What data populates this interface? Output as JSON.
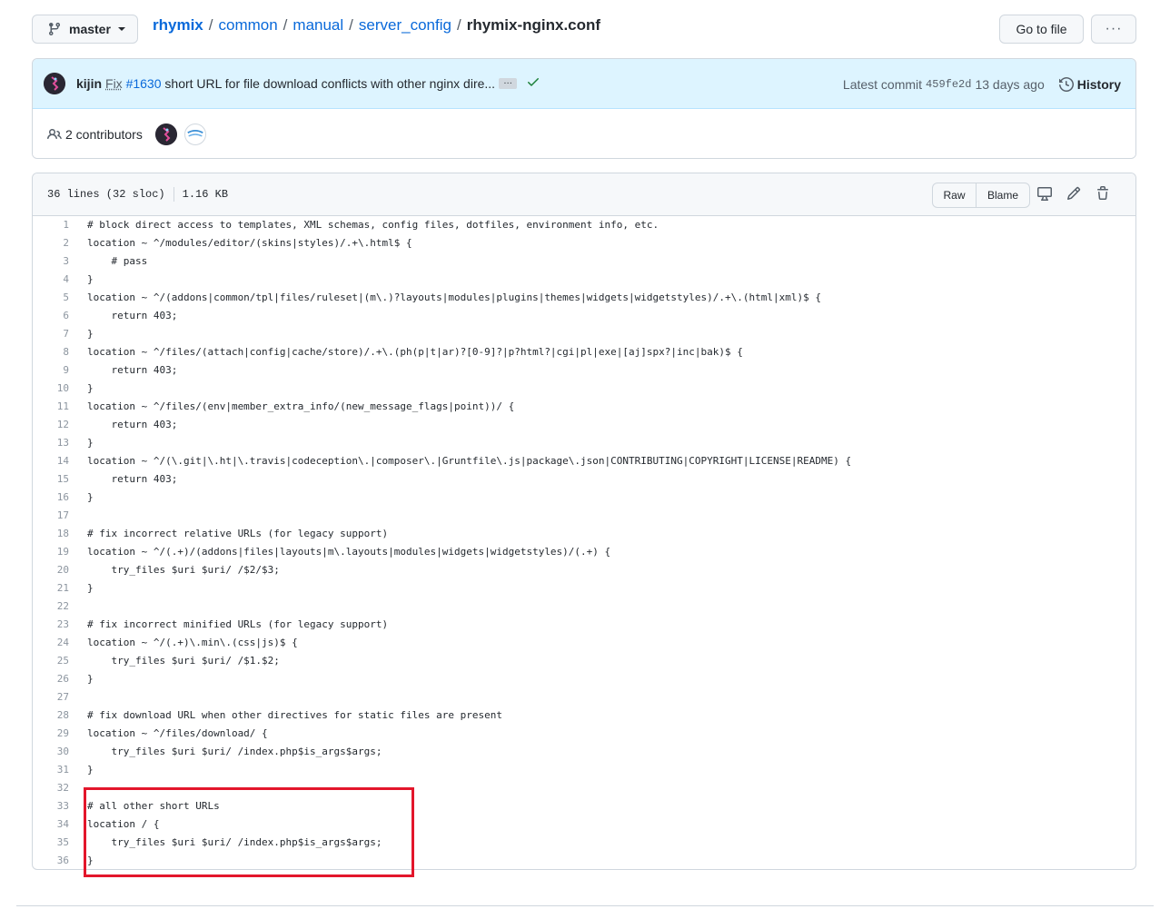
{
  "branch": {
    "label": "master"
  },
  "breadcrumb": {
    "repo": "rhymix",
    "parts": [
      "common",
      "manual",
      "server_config"
    ],
    "file": "rhymix-nginx.conf"
  },
  "top_actions": {
    "go_to_file": "Go to file",
    "more": "···"
  },
  "commit": {
    "author": "kijin",
    "fix_word": "Fix",
    "issue": "#1630",
    "message_rest": "short URL for file download conflicts with other nginx dire...",
    "ellipsis": "…",
    "latest_label": "Latest commit",
    "sha": "459fe2d",
    "time_ago": "13 days ago",
    "history_label": "History",
    "status_color": "#1a7f37"
  },
  "contributors": {
    "label": "2 contributors"
  },
  "file": {
    "lines_info": "36 lines (32 sloc)",
    "size": "1.16 KB",
    "raw_label": "Raw",
    "blame_label": "Blame"
  },
  "code_lines": [
    "# block direct access to templates, XML schemas, config files, dotfiles, environment info, etc.",
    "location ~ ^/modules/editor/(skins|styles)/.+\\.html$ {",
    "    # pass",
    "}",
    "location ~ ^/(addons|common/tpl|files/ruleset|(m\\.)?layouts|modules|plugins|themes|widgets|widgetstyles)/.+\\.(html|xml)$ {",
    "    return 403;",
    "}",
    "location ~ ^/files/(attach|config|cache/store)/.+\\.(ph(p|t|ar)?[0-9]?|p?html?|cgi|pl|exe|[aj]spx?|inc|bak)$ {",
    "    return 403;",
    "}",
    "location ~ ^/files/(env|member_extra_info/(new_message_flags|point))/ {",
    "    return 403;",
    "}",
    "location ~ ^/(\\.git|\\.ht|\\.travis|codeception\\.|composer\\.|Gruntfile\\.js|package\\.json|CONTRIBUTING|COPYRIGHT|LICENSE|README) {",
    "    return 403;",
    "}",
    "",
    "# fix incorrect relative URLs (for legacy support)",
    "location ~ ^/(.+)/(addons|files|layouts|m\\.layouts|modules|widgets|widgetstyles)/(.+) {",
    "    try_files $uri $uri/ /$2/$3;",
    "}",
    "",
    "# fix incorrect minified URLs (for legacy support)",
    "location ~ ^/(.+)\\.min\\.(css|js)$ {",
    "    try_files $uri $uri/ /$1.$2;",
    "}",
    "",
    "# fix download URL when other directives for static files are present",
    "location ~ ^/files/download/ {",
    "    try_files $uri $uri/ /index.php$is_args$args;",
    "}",
    "",
    "# all other short URLs",
    "location / {",
    "    try_files $uri $uri/ /index.php$is_args$args;",
    "}"
  ],
  "highlight_color": "#e3162b"
}
